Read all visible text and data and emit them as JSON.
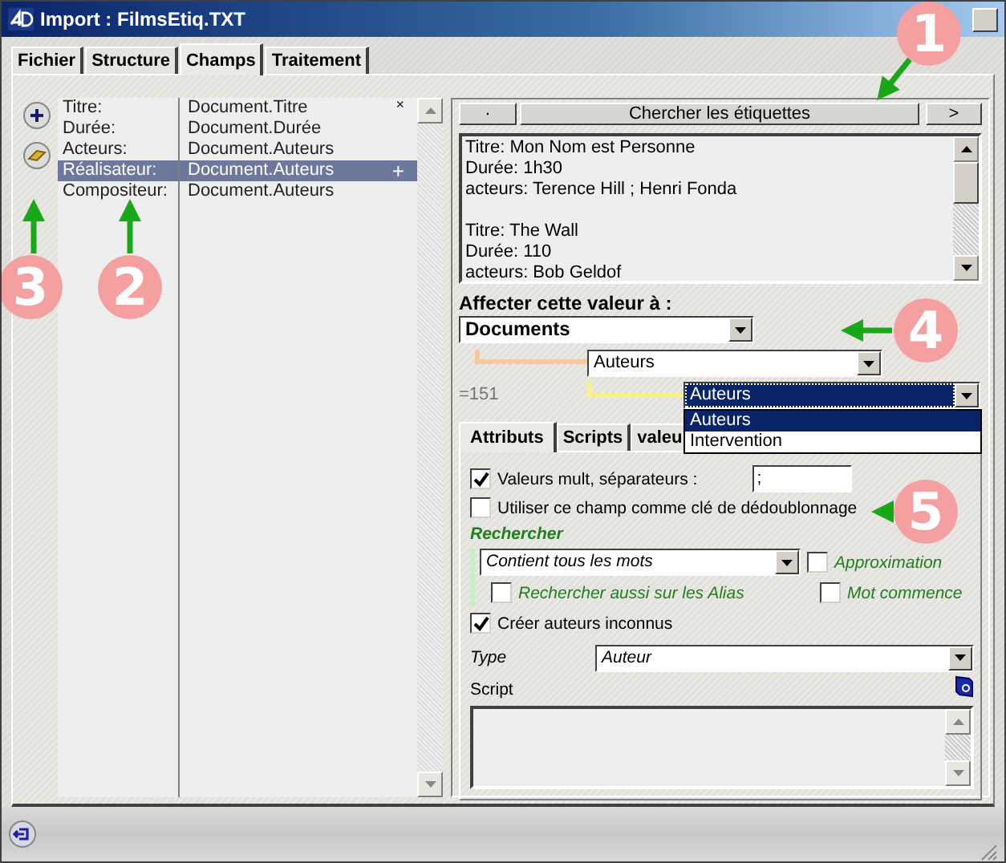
{
  "window": {
    "title": "Import : FilmsEtiq.TXT"
  },
  "tabs": [
    {
      "label": "Fichier",
      "selected": false
    },
    {
      "label": "Structure",
      "selected": false
    },
    {
      "label": "Champs",
      "selected": true
    },
    {
      "label": "Traitement",
      "selected": false
    }
  ],
  "fields": [
    {
      "label": "Titre:",
      "target": "Document.Titre",
      "marker": "×",
      "selected": false
    },
    {
      "label": "Durée:",
      "target": "Document.Durée",
      "selected": false
    },
    {
      "label": "Acteurs:",
      "target": "Document.Auteurs",
      "selected": false
    },
    {
      "label": "Réalisateur:",
      "target": "Document.Auteurs",
      "marker": "+",
      "selected": true
    },
    {
      "label": "Compositeur:",
      "target": "Document.Auteurs",
      "selected": false
    }
  ],
  "search_bar": {
    "previous": "·",
    "button": "Chercher les étiquettes",
    "next": ">"
  },
  "preview": [
    [
      "Titre: Mon Nom est Personne",
      "Durée: 1h30",
      "acteurs: Terence Hill ; Henri Fonda"
    ],
    [
      "Titre: The Wall",
      "Durée: 110",
      "acteurs: Bob Geldof"
    ]
  ],
  "assign": {
    "label": "Affecter cette valeur à :",
    "table": "Documents",
    "field": "Auteurs",
    "count": "=151",
    "subfield": "Auteurs",
    "options": [
      {
        "label": "Auteurs",
        "selected": true
      },
      {
        "label": "Intervention",
        "selected": false
      }
    ]
  },
  "inner_tabs": [
    {
      "label": "Attributs",
      "selected": true
    },
    {
      "label": "Scripts",
      "selected": false
    },
    {
      "label": "valeu",
      "selected": false
    }
  ],
  "multi_values": {
    "checked": true,
    "label": "Valeurs mult, séparateurs :",
    "value": ";"
  },
  "dedup": {
    "checked": false,
    "label": "Utiliser ce champ comme clé de dédoublonnage"
  },
  "search": {
    "title": "Rechercher",
    "mode": "Contient tous les mots",
    "approximation": {
      "checked": false,
      "label": "Approximation"
    },
    "alias": {
      "checked": false,
      "label": "Rechercher aussi sur les Alias"
    },
    "word_start": {
      "checked": false,
      "label": "Mot commence"
    }
  },
  "create_unknown": {
    "checked": true,
    "label": "Créer auteurs inconnus"
  },
  "type": {
    "label": "Type",
    "value": "Auteur"
  },
  "script": {
    "label": "Script"
  },
  "callouts": [
    "1",
    "2",
    "3",
    "4",
    "5"
  ]
}
